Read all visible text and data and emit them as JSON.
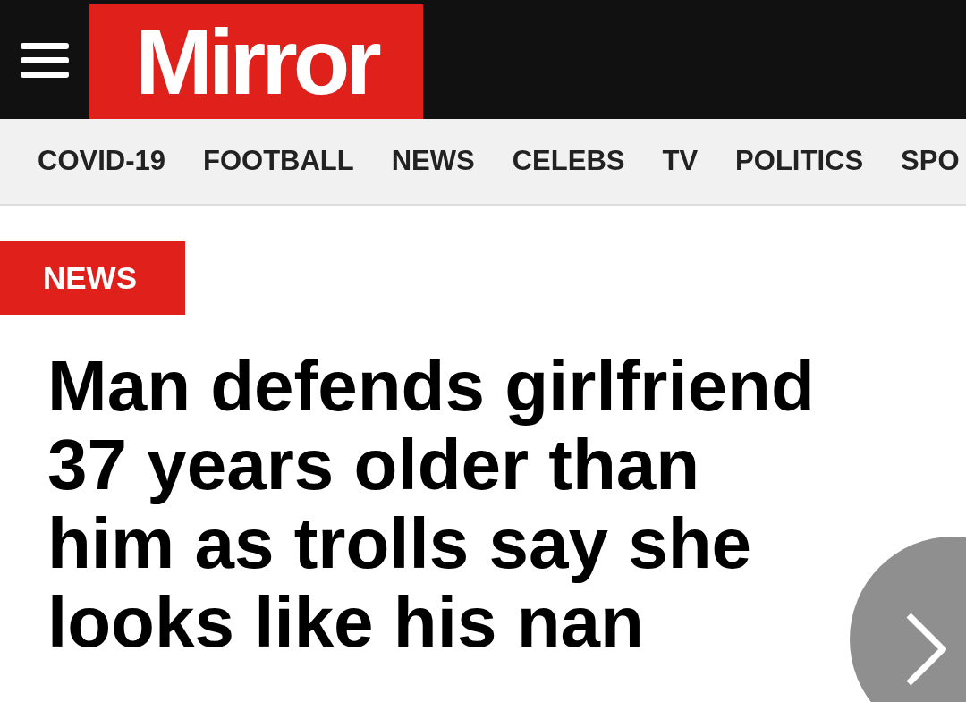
{
  "header": {
    "logo": "Mirror"
  },
  "nav": {
    "items": [
      {
        "label": "COVID-19"
      },
      {
        "label": "FOOTBALL"
      },
      {
        "label": "NEWS"
      },
      {
        "label": "CELEBS"
      },
      {
        "label": "TV"
      },
      {
        "label": "POLITICS"
      },
      {
        "label": "SPO"
      }
    ]
  },
  "article": {
    "section": "NEWS",
    "headline": "Man defends girlfriend 37 years older than him as trolls say she looks like his nan"
  }
}
